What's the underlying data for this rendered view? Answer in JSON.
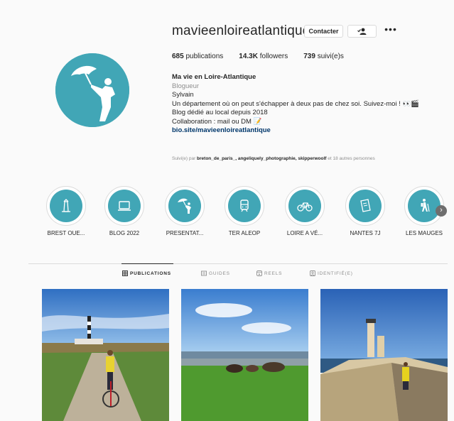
{
  "profile": {
    "username": "mavieenloireatlantique",
    "buttons": {
      "contact": "Contacter",
      "follow_icon": "person-check-icon",
      "more": "•••"
    },
    "stats": [
      {
        "count": "685",
        "label": "publications"
      },
      {
        "count": "14.3K",
        "label": "followers"
      },
      {
        "count": "739",
        "label": "suivi(e)s"
      }
    ],
    "bio": {
      "name": "Ma vie en Loire-Atlantique",
      "category": "Blogueur",
      "lines": [
        "Sylvain",
        "Un département où on peut s'échapper à deux pas de chez soi. Suivez-moi ! 👀🎬",
        "Blog dédié au local depuis 2018",
        "Collaboration : mail ou DM 📝"
      ],
      "link": "bio.site/mavieenloireatlantique"
    },
    "followed_by": {
      "prefix": "Suivi(e) par",
      "names": "breton_de_paris_, angeliquely_photographie, skipperwoolf",
      "suffix": "et 18 autres personnes"
    }
  },
  "highlights": [
    {
      "label": "BREST OUE...",
      "icon": "lighthouse-icon"
    },
    {
      "label": "BLOG 2022",
      "icon": "laptop-icon"
    },
    {
      "label": "PRESENTAT...",
      "icon": "umbrella-person-icon"
    },
    {
      "label": "TER ALEOP",
      "icon": "train-icon"
    },
    {
      "label": "LOIRE A VÉ...",
      "icon": "bicycle-icon"
    },
    {
      "label": "NANTES 7J",
      "icon": "map-icon"
    },
    {
      "label": "LES MAUGES",
      "icon": "hiker-icon"
    }
  ],
  "tabs": [
    {
      "label": "PUBLICATIONS",
      "icon": "grid-icon",
      "active": true
    },
    {
      "label": "GUIDES",
      "icon": "guide-icon",
      "active": false
    },
    {
      "label": "REELS",
      "icon": "reels-icon",
      "active": false
    },
    {
      "label": "IDENTIFIÉ(E)",
      "icon": "tag-icon",
      "active": false
    }
  ],
  "colors": {
    "brand_teal": "#41a6b6",
    "link": "#00376b",
    "muted": "#8e8e8e"
  }
}
